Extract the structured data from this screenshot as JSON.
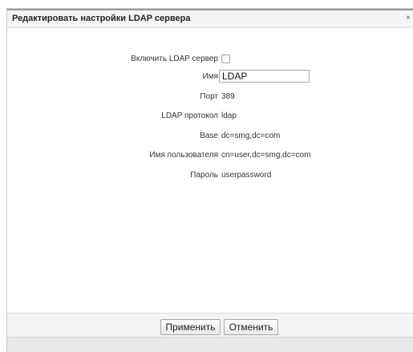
{
  "dialog": {
    "title": "Редактировать настройки LDAP сервера",
    "close_glyph": "×"
  },
  "form": {
    "enable": {
      "label": "Включить LDAP сервер",
      "checked": false
    },
    "name": {
      "label": "Имя",
      "value": "LDAP"
    },
    "port": {
      "label": "Порт",
      "value": "389"
    },
    "protocol": {
      "label": "LDAP протокол",
      "value": "ldap"
    },
    "base": {
      "label": "Base",
      "value": "dc=smg,dc=com"
    },
    "username": {
      "label": "Имя пользователя",
      "value": "cn=user,dc=smg,dc=com"
    },
    "password": {
      "label": "Пароль",
      "value": "userpassword"
    }
  },
  "footer": {
    "apply_label": "Применить",
    "cancel_label": "Отменить"
  }
}
